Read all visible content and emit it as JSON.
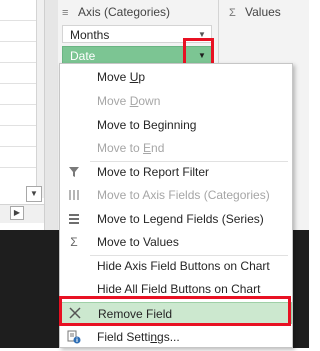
{
  "pane": {
    "axis_header": "Axis (Categories)",
    "axis_icon": "list-icon",
    "values_header": "Values",
    "values_icon": "sigma-icon",
    "fields": [
      {
        "label": "Months"
      },
      {
        "label": "Date"
      }
    ]
  },
  "menu": {
    "items": [
      {
        "label": "Move Up",
        "underline": "U",
        "enabled": true,
        "icon": ""
      },
      {
        "label": "Move Down",
        "underline": "D",
        "enabled": false,
        "icon": ""
      },
      {
        "label": "Move to Beginning",
        "underline": "g",
        "enabled": true,
        "icon": ""
      },
      {
        "label": "Move to End",
        "underline": "E",
        "enabled": false,
        "icon": ""
      },
      {
        "label": "Move to Report Filter",
        "enabled": true,
        "icon": "filter-icon"
      },
      {
        "label": "Move to Axis Fields (Categories)",
        "enabled": false,
        "icon": "columns-icon"
      },
      {
        "label": "Move to Legend Fields (Series)",
        "enabled": true,
        "icon": "rows-icon"
      },
      {
        "label": "Move to Values",
        "enabled": true,
        "icon": "sigma-icon"
      },
      {
        "label": "Hide Axis Field Buttons on Chart",
        "enabled": true,
        "icon": ""
      },
      {
        "label": "Hide All Field Buttons on Chart",
        "enabled": true,
        "icon": ""
      },
      {
        "label": "Remove Field",
        "enabled": true,
        "icon": "remove-x-icon"
      },
      {
        "label": "Field Settings...",
        "underline": "N",
        "enabled": true,
        "icon": "field-settings-icon"
      }
    ]
  },
  "colors": {
    "accent_green": "#7cc593",
    "highlight_red": "#e81123",
    "remove_field_bg": "#cce8cf"
  }
}
